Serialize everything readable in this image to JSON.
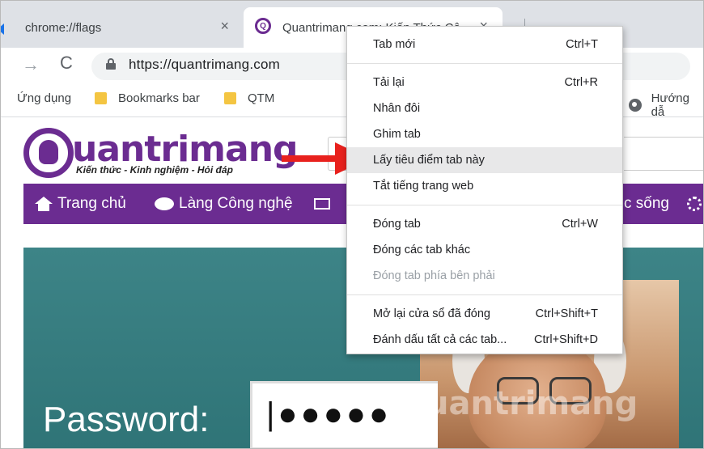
{
  "tabs": [
    {
      "title": "chrome://flags",
      "close": "×"
    },
    {
      "title": "Quantrimang.com: Kiến Thức Cô",
      "close": "×"
    }
  ],
  "toolbar": {
    "back": "→",
    "reload": "C",
    "url": "https://quantrimang.com"
  },
  "bookmarks": [
    {
      "label": "Ứng dụng"
    },
    {
      "label": "Bookmarks bar"
    },
    {
      "label": "QTM"
    },
    {
      "label": "Hướng dẫ"
    }
  ],
  "site": {
    "logo_text": "uantrimang",
    "logo_tagline": "Kiến thức - Kinh nghiệm - Hỏi đáp",
    "nav": [
      {
        "label": "Trang chủ"
      },
      {
        "label": "Làng Công nghệ"
      },
      {
        "label": "c sống"
      }
    ],
    "hero_password_label": "Password:",
    "hero_password_dots": "|●●●●●",
    "watermark": "uantrimang"
  },
  "context_menu": {
    "groups": [
      [
        {
          "label": "Tab mới",
          "shortcut": "Ctrl+T"
        }
      ],
      [
        {
          "label": "Tải lại",
          "shortcut": "Ctrl+R"
        },
        {
          "label": "Nhân đôi",
          "shortcut": ""
        },
        {
          "label": "Ghim tab",
          "shortcut": ""
        },
        {
          "label": "Lấy tiêu điểm tab này",
          "shortcut": "",
          "highlighted": true
        },
        {
          "label": "Tắt tiếng trang web",
          "shortcut": ""
        }
      ],
      [
        {
          "label": "Đóng tab",
          "shortcut": "Ctrl+W"
        },
        {
          "label": "Đóng các tab khác",
          "shortcut": ""
        },
        {
          "label": "Đóng tab phía bên phải",
          "shortcut": "",
          "disabled": true
        }
      ],
      [
        {
          "label": "Mở lại cửa sổ đã đóng",
          "shortcut": "Ctrl+Shift+T"
        },
        {
          "label": "Đánh dấu tất cả các tab...",
          "shortcut": "Ctrl+Shift+D"
        }
      ]
    ]
  },
  "colors": {
    "brand_purple": "#6b2c91",
    "arrow_red": "#e8211d",
    "hero_teal": "#2f7477"
  }
}
